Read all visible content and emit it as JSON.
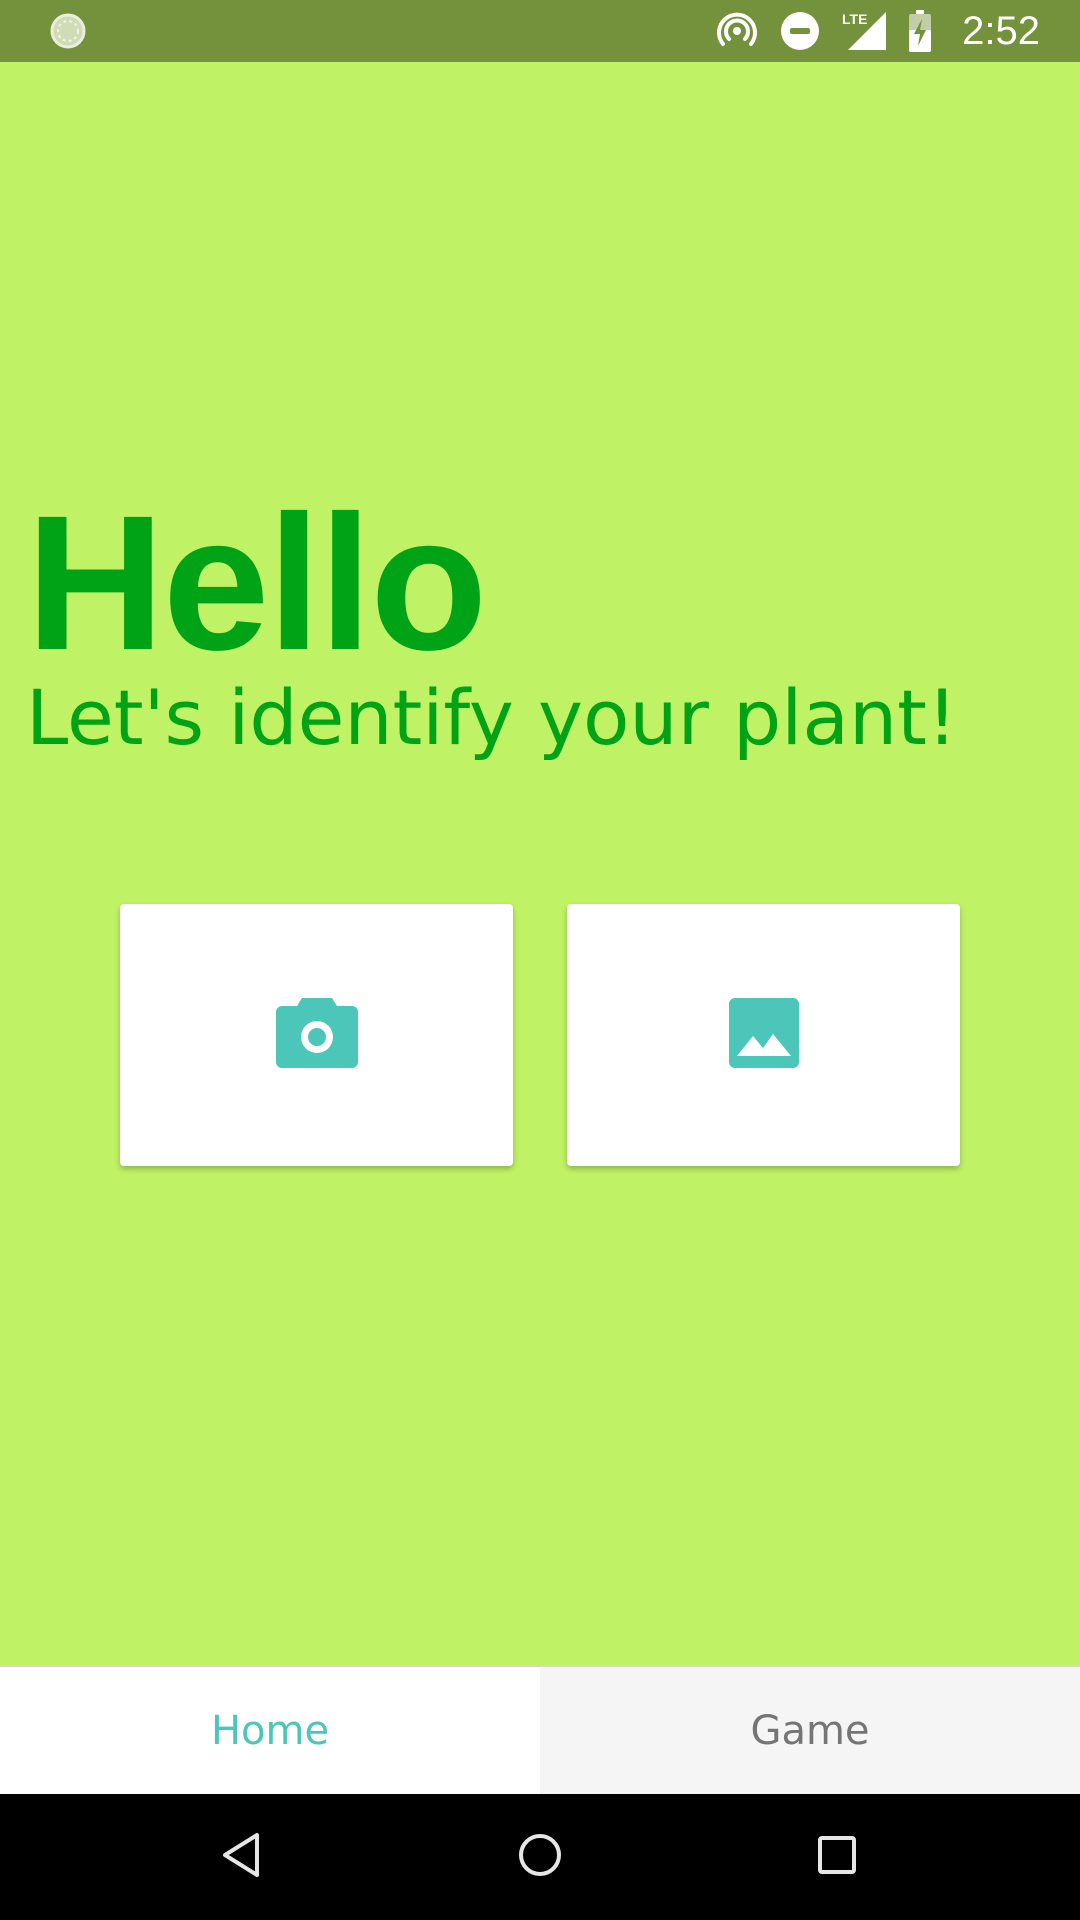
{
  "status_bar": {
    "time": "2:52",
    "network": "LTE",
    "icons": [
      "loading-icon",
      "hotspot-icon",
      "do-not-disturb-icon",
      "lte-signal-icon",
      "battery-charging-icon"
    ]
  },
  "main": {
    "greeting": "Hello",
    "subtitle": "Let's identify your plant!",
    "actions": [
      {
        "icon": "camera-icon"
      },
      {
        "icon": "image-icon"
      }
    ]
  },
  "tabs": [
    {
      "label": "Home",
      "active": true
    },
    {
      "label": "Game",
      "active": false
    }
  ],
  "nav_bar": {
    "buttons": [
      "back-icon",
      "home-circle-icon",
      "recents-icon"
    ]
  },
  "colors": {
    "status_bar": "#74913c",
    "background": "#c0f265",
    "text_green": "#00a316",
    "icon_teal": "#4cc6b8",
    "tab_active": "#4cc6b8",
    "tab_inactive": "#757575"
  }
}
